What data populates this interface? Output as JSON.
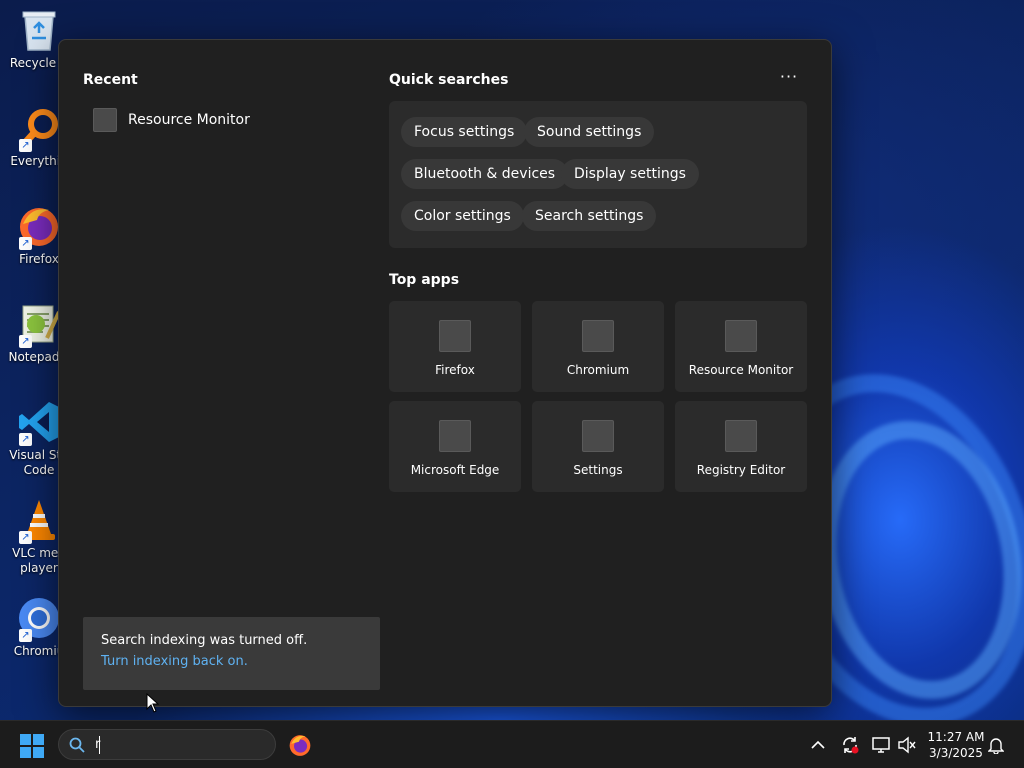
{
  "desktop": {
    "icons": [
      {
        "label": "Recycle B",
        "icon": "recycle-bin-icon"
      },
      {
        "label": "Everythin",
        "icon": "everything-search-icon"
      },
      {
        "label": "Firefox",
        "icon": "firefox-icon"
      },
      {
        "label": "Notepad+",
        "icon": "notepad-plus-plus-icon"
      },
      {
        "label": "Visual Stu\nCode",
        "icon": "vscode-icon"
      },
      {
        "label": "VLC med\nplayer",
        "icon": "vlc-icon"
      },
      {
        "label": "Chromiu",
        "icon": "chromium-icon"
      }
    ]
  },
  "panel": {
    "recent": {
      "title": "Recent",
      "items": [
        {
          "label": "Resource Monitor"
        }
      ]
    },
    "quick_searches": {
      "title": "Quick searches",
      "more_label": "···",
      "chips": [
        {
          "label": "Focus settings"
        },
        {
          "label": "Sound settings"
        },
        {
          "label": "Bluetooth & devices"
        },
        {
          "label": "Display settings"
        },
        {
          "label": "Color settings"
        },
        {
          "label": "Search settings"
        }
      ]
    },
    "top_apps": {
      "title": "Top apps",
      "apps": [
        {
          "label": "Firefox"
        },
        {
          "label": "Chromium"
        },
        {
          "label": "Resource Monitor"
        },
        {
          "label": "Microsoft Edge"
        },
        {
          "label": "Settings"
        },
        {
          "label": "Registry Editor"
        }
      ]
    },
    "notice": {
      "message": "Search indexing was turned off.",
      "link": "Turn indexing back on."
    }
  },
  "taskbar": {
    "search": {
      "query": "r"
    },
    "pinned": [
      {
        "icon": "firefox-icon"
      }
    ],
    "tray": [
      {
        "icon": "chevron-up-icon"
      },
      {
        "icon": "sync-alert-icon"
      },
      {
        "icon": "network-icon"
      },
      {
        "icon": "volume-muted-icon"
      }
    ],
    "clock": {
      "time": "11:27 AM",
      "date": "3/3/2025"
    },
    "notifications_icon": "bell-icon"
  },
  "colors": {
    "panel_bg": "#202020",
    "tile_bg": "#2b2b2b",
    "chip_bg": "#383838",
    "link": "#5fb2f2",
    "taskbar_bg": "#1c1c1c"
  }
}
